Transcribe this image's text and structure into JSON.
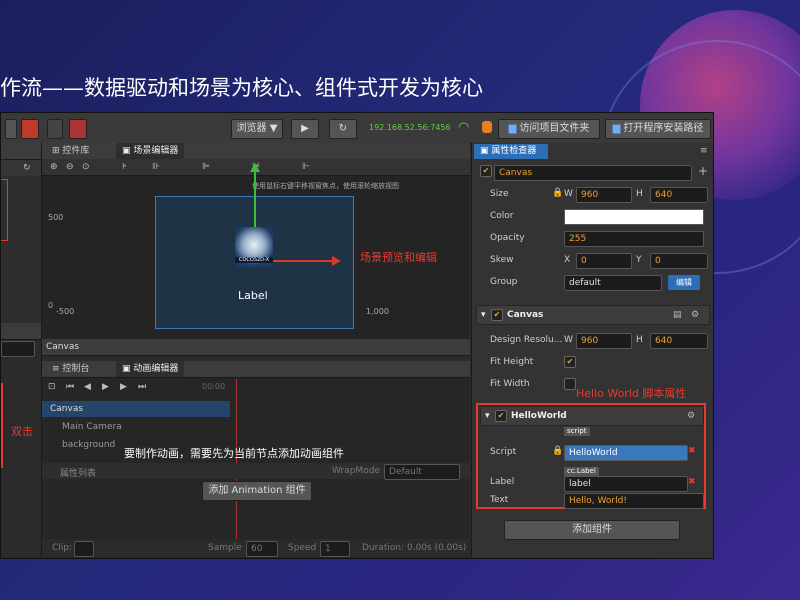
{
  "slide": {
    "title": "作流——数据驱动和场景为核心、组件式开发为核心"
  },
  "toolbar": {
    "browser_select": "浏览器 ▼",
    "play_icon": "play-icon",
    "refresh_icon": "refresh-icon",
    "ip_address": "192.168.52.56:7456",
    "visit_button": "访问项目文件夹",
    "open_button": "打开程序安装路径"
  },
  "left_panel": {
    "mark_500": "500",
    "mark_0": "0",
    "double_click_note": "双击"
  },
  "assets_panel": {
    "tab_controls": "控件库",
    "tab_scene_editor": "场景编辑器"
  },
  "scene": {
    "hint": "使用鼠标右键平移视窗焦点，使用滚轮缩放视图",
    "axis_y_500": "500",
    "axis_y_0": "0",
    "axis_x_neg500": "-500",
    "axis_x_0": "0",
    "axis_x_500": "500",
    "axis_x_1000": "1,000",
    "logo_text": "COCOS2D-X",
    "node_label": "Label",
    "annotation": "场景预览和编辑"
  },
  "canvas_bar": {
    "label": "Canvas"
  },
  "anim_panel": {
    "tab_console": "控制台",
    "tab_animation": "动画编辑器",
    "time_readout": "00:00",
    "tree_items": [
      "Canvas",
      "Main Camera",
      "background"
    ],
    "message": "要制作动画，需要先为当前节点添加动画组件",
    "property_list": "属性列表",
    "wrap_mode_label": "WrapMode",
    "wrap_mode_value": "Default",
    "add_button": "添加 Animation 组件",
    "clip_label": "Clip:",
    "sample_label": "Sample",
    "sample_value": "60",
    "speed_label": "Speed",
    "speed_value": "1",
    "duration": "Duration: 0.00s (0.00s)"
  },
  "inspector": {
    "tab": "属性检查器",
    "node_name": "Canvas",
    "size_label": "Size",
    "w": "W",
    "h": "H",
    "size_w": "960",
    "size_h": "640",
    "color_label": "Color",
    "opacity_label": "Opacity",
    "opacity_value": "255",
    "skew_label": "Skew",
    "x": "X",
    "y": "Y",
    "skew_x": "0",
    "skew_y": "0",
    "group_label": "Group",
    "group_value": "default",
    "edit_button": "编辑",
    "canvas_section": "Canvas",
    "design_label": "Design Resolu...",
    "design_w": "960",
    "design_h": "640",
    "fit_height_label": "Fit Height",
    "fit_width_label": "Fit Width",
    "script_note": "Hello World 脚本属性",
    "hello_section": "HelloWorld",
    "script_label": "Script",
    "script_tag": "script",
    "script_value": "HelloWorld",
    "label_label": "Label",
    "label_tag": "cc.Label",
    "label_value": "label",
    "text_label": "Text",
    "text_value": "Hello, World!",
    "add_component": "添加组件"
  },
  "colors": {
    "accent_red": "#e83a2c",
    "accent_blue": "#2d6fb7",
    "orange": "#f0a030"
  }
}
